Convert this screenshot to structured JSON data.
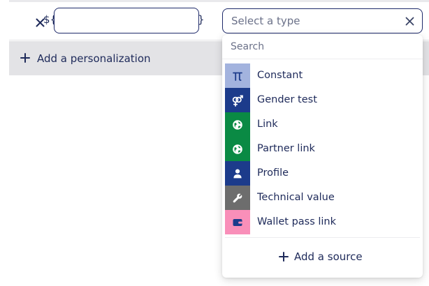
{
  "variable": {
    "prefix": "${",
    "suffix": "}",
    "value": ""
  },
  "type_select": {
    "placeholder": "Select a type"
  },
  "actions": {
    "add_personalization": "Add a personalization"
  },
  "dropdown": {
    "search_placeholder": "Search",
    "options": [
      {
        "label": "Constant",
        "icon": "pi-icon",
        "color": "#a3b3de"
      },
      {
        "label": "Gender test",
        "icon": "gender-icon",
        "color": "#1c3b8b"
      },
      {
        "label": "Link",
        "icon": "globe-icon",
        "color": "#0a8a44"
      },
      {
        "label": "Partner link",
        "icon": "globe-icon",
        "color": "#0a8a44"
      },
      {
        "label": "Profile",
        "icon": "user-icon",
        "color": "#1c3b8b"
      },
      {
        "label": "Technical value",
        "icon": "wrench-icon",
        "color": "#6d6d6d"
      },
      {
        "label": "Wallet pass link",
        "icon": "wallet-icon",
        "color": "#f98fb9"
      }
    ],
    "add_source": "Add a source"
  }
}
